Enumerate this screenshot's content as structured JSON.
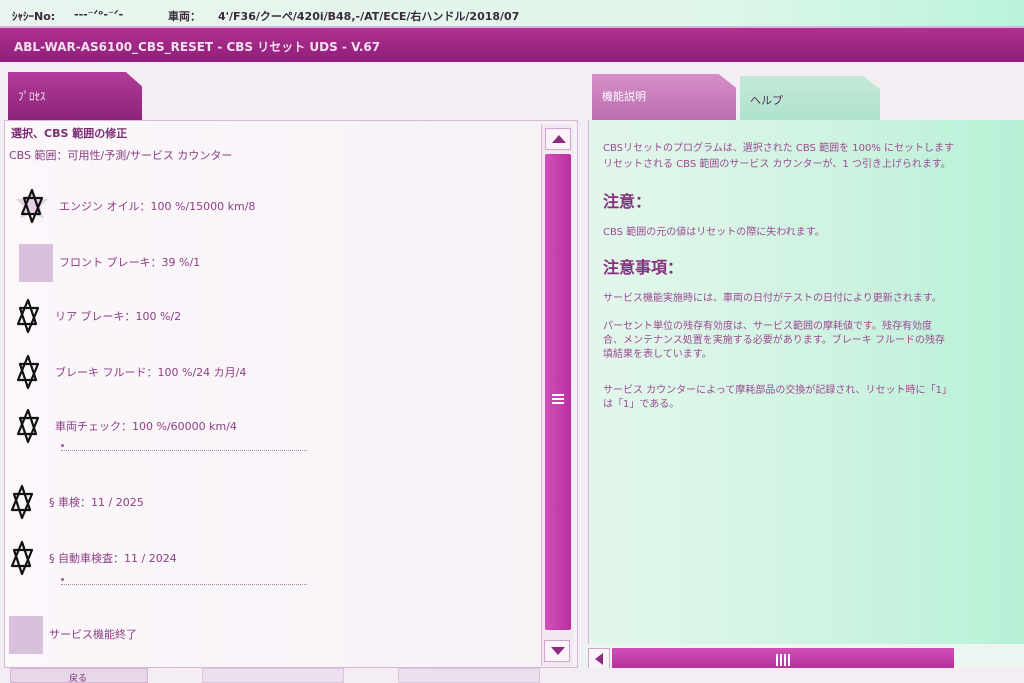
{
  "vehicle": {
    "chassis_label": "ｼｬｼｰNo:",
    "chassis_value": "---⁻ᐟᵒ-⁻ᐟ-",
    "vehicle_label": "車両：",
    "vehicle_value": "4'/F36/クーペ/420i/B48,-/AT/ECE/右ハンドル/2018/07"
  },
  "title": "ABL-WAR-AS6100_CBS_RESET - CBS リセット UDS - V.67",
  "tabs": {
    "process": "ﾌﾟﾛｾｽ",
    "function_desc": "機能説明",
    "help": "ヘルプ"
  },
  "left": {
    "heading": "選択、CBS 範囲の修正",
    "subheading": "CBS 範囲：可用性/予測/サービス カウンター",
    "items": [
      {
        "label": "エンジン オイル：100 %/15000 km/8",
        "icon": "star-icon"
      },
      {
        "label": "フロント ブレーキ：39 %/1",
        "icon": "none"
      },
      {
        "label": "リア ブレーキ：100 %/2",
        "icon": "star-icon"
      },
      {
        "label": "ブレーキ フルード：100 %/24 カ月/4",
        "icon": "star-icon"
      },
      {
        "label": "車両チェック：100 %/60000 km/4",
        "icon": "star-icon"
      },
      {
        "label": "§ 車検：11 / 2025",
        "icon": "star-icon"
      },
      {
        "label": "§ 自動車検査：11 / 2024",
        "icon": "star-icon"
      },
      {
        "label": "サービス機能終了",
        "icon": "none"
      }
    ]
  },
  "right": {
    "intro_line1": "CBSリセットのプログラムは、選択された CBS 範囲を 100% にセットします",
    "intro_line2": "リセットされる CBS 範囲のサービス カウンターが、1 つ引き上げられます。",
    "caution_heading": "注意：",
    "caution_text": "CBS 範囲の元の値はリセットの際に失われます。",
    "notes_heading": "注意事項：",
    "note1": "サービス機能実施時には、車両の日付がテストの日付により更新されます。",
    "note2_line1": "パーセント単位の残存有効度は、サービス範囲の摩耗値です。残存有効度",
    "note2_line2": "合、メンテナンス処置を実施する必要があります。ブレーキ フルードの残存",
    "note2_line3": "填結果を表しています。",
    "note3_line1": "サービス カウンターによって摩耗部品の交換が記録され、リセット時に「1」",
    "note3_line2": "は「1」である。"
  },
  "footer": {
    "back": "戻る"
  },
  "colors": {
    "accent": "#b33a9a",
    "panel_green": "#cdf3e0"
  }
}
